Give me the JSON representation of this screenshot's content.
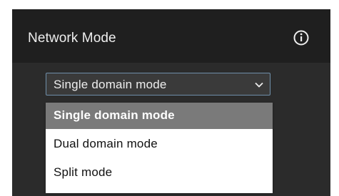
{
  "panel": {
    "title": "Network Mode",
    "info_icon": "info-circle-icon"
  },
  "network_mode_select": {
    "value": "Single domain mode",
    "options": [
      {
        "label": "Single domain mode",
        "selected": true
      },
      {
        "label": "Dual domain mode",
        "selected": false
      },
      {
        "label": "Split mode",
        "selected": false
      }
    ]
  },
  "colors": {
    "panel_bg": "#2b2b2b",
    "header_bg": "#1f1f1f",
    "select_border": "#6f8faa",
    "selected_option_bg": "#7a7a7a"
  }
}
